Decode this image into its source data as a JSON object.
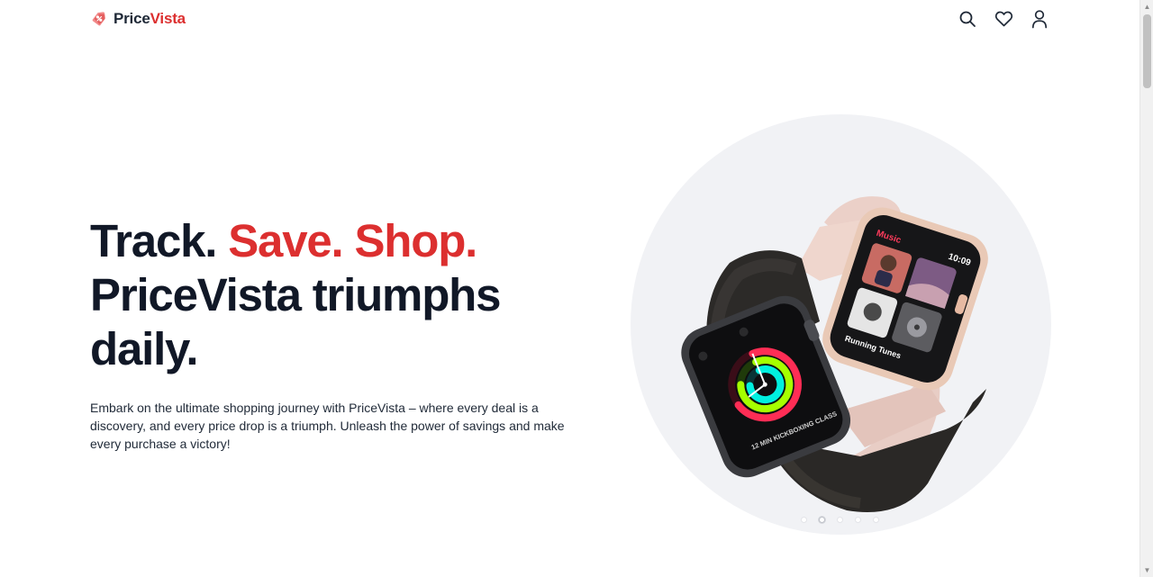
{
  "brand": {
    "name_part1": "Price",
    "name_part2": "Vista",
    "logo_icon": "price-tag-icon",
    "accent_color": "#dc2f2f",
    "text_color": "#111827"
  },
  "header": {
    "icons": [
      "search-icon",
      "heart-icon",
      "user-icon"
    ]
  },
  "hero": {
    "headline_part1": "Track.",
    "headline_accent": "Save. Shop.",
    "headline_line2": "PriceVista triumphs",
    "headline_line3": "daily.",
    "description": "Embark on the ultimate shopping journey with PriceVista – where every deal is a discovery, and every price drop is a triumph. Unleash the power of savings and make every purchase a victory!",
    "image_alt": "Apple Watch pair product image",
    "watch_screen_1": {
      "app": "Music",
      "time": "10:09",
      "track": "Running Tunes"
    },
    "watch_screen_2": {
      "workout": "12 MIN KICKBOXING CLASS"
    }
  },
  "carousel": {
    "slide_count": 5,
    "active_index": 1
  }
}
